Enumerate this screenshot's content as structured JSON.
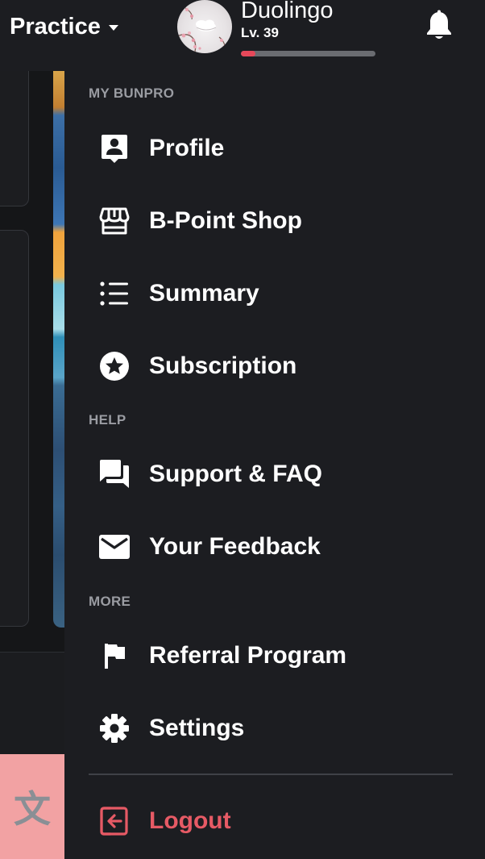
{
  "header": {
    "practice_label": "Practice",
    "user_name": "Duolingo",
    "user_level": "Lv. 39",
    "xp_progress": 0.11
  },
  "drawer": {
    "sections": {
      "my_bunpro": "MY BUNPRO",
      "help": "HELP",
      "more": "MORE"
    },
    "items": {
      "profile": "Profile",
      "shop": "B-Point Shop",
      "summary": "Summary",
      "subscription": "Subscription",
      "support": "Support & FAQ",
      "feedback": "Your Feedback",
      "referral": "Referral Program",
      "settings": "Settings",
      "logout": "Logout"
    }
  },
  "logo_glyph": "文",
  "colors": {
    "accent_red": "#e65a65",
    "drawer_bg": "#1c1d21",
    "logo_bg": "#f2a2a3"
  },
  "icons": {
    "profile": "profile-card-icon",
    "shop": "storefront-icon",
    "summary": "list-icon",
    "subscription": "star-circle-icon",
    "support": "chat-bubbles-icon",
    "feedback": "envelope-icon",
    "referral": "flag-icon",
    "settings": "gear-icon",
    "logout": "logout-icon",
    "notifications": "bell-icon"
  }
}
